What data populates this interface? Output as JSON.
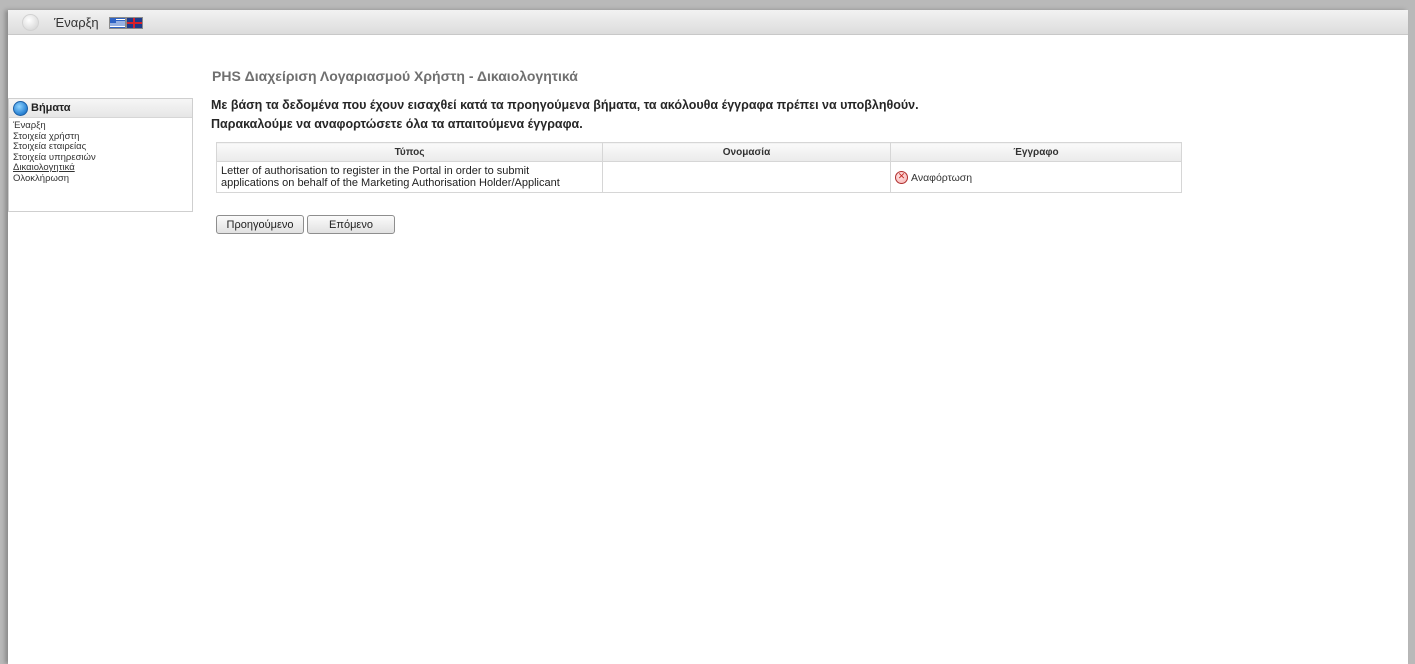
{
  "topbar": {
    "home_label": "Έναρξη"
  },
  "steps": {
    "title": "Βήματα",
    "items": [
      {
        "label": "Έναρξη"
      },
      {
        "label": "Στοιχεία χρήστη"
      },
      {
        "label": "Στοιχεία εταιρείας"
      },
      {
        "label": "Στοιχεία υπηρεσιών"
      },
      {
        "label": "Δικαιολογητικά"
      },
      {
        "label": "Ολοκλήρωση"
      }
    ]
  },
  "page": {
    "title": "PHS Διαχείριση Λογαριασμού Χρήστη - Δικαιολογητικά",
    "intro_line1": "Με βάση τα δεδομένα που έχουν εισαχθεί κατά τα προηγούμενα βήματα, τα ακόλουθα έγγραφα πρέπει να υποβληθούν.",
    "intro_line2": "Παρακαλούμε να αναφορτώσετε όλα τα απαιτούμενα έγγραφα."
  },
  "table": {
    "headers": [
      "Τύπος",
      "Ονομασία",
      "Έγγραφο"
    ],
    "rows": [
      {
        "type_line1": "Letter of authorisation to register in the Portal in order to submit",
        "type_line2": "applications on behalf of the Marketing Authorisation Holder/Applicant",
        "name": "",
        "upload_label": "Αναφόρτωση"
      }
    ]
  },
  "buttons": {
    "previous": "Προηγούμενο",
    "next": "Επόμενο"
  },
  "icons": {
    "window": "window-circle-icon",
    "flag_el": "greek-flag-icon",
    "flag_en": "uk-flag-icon",
    "steps": "steps-globe-icon",
    "upload": "upload-error-icon"
  }
}
